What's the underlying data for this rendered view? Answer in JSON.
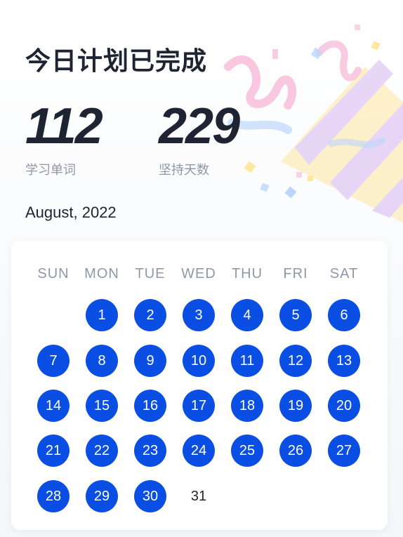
{
  "header": {
    "title": "今日计划已完成"
  },
  "stats": [
    {
      "value": "112",
      "label": "学习单词"
    },
    {
      "value": "229",
      "label": "坚持天数"
    }
  ],
  "calendar": {
    "month_label": "August, 2022",
    "weekdays": [
      "SUN",
      "MON",
      "TUE",
      "WED",
      "THU",
      "FRI",
      "SAT"
    ],
    "days": [
      {
        "n": "1",
        "done": true
      },
      {
        "n": "2",
        "done": true
      },
      {
        "n": "3",
        "done": true
      },
      {
        "n": "4",
        "done": true
      },
      {
        "n": "5",
        "done": true
      },
      {
        "n": "6",
        "done": true
      },
      {
        "n": "7",
        "done": true
      },
      {
        "n": "8",
        "done": true
      },
      {
        "n": "9",
        "done": true
      },
      {
        "n": "10",
        "done": true
      },
      {
        "n": "11",
        "done": true
      },
      {
        "n": "12",
        "done": true
      },
      {
        "n": "13",
        "done": true
      },
      {
        "n": "14",
        "done": true
      },
      {
        "n": "15",
        "done": true
      },
      {
        "n": "16",
        "done": true
      },
      {
        "n": "17",
        "done": true
      },
      {
        "n": "18",
        "done": true
      },
      {
        "n": "19",
        "done": true
      },
      {
        "n": "20",
        "done": true
      },
      {
        "n": "21",
        "done": true
      },
      {
        "n": "22",
        "done": true
      },
      {
        "n": "23",
        "done": true
      },
      {
        "n": "24",
        "done": true
      },
      {
        "n": "25",
        "done": true
      },
      {
        "n": "26",
        "done": true
      },
      {
        "n": "27",
        "done": true
      },
      {
        "n": "28",
        "done": true
      },
      {
        "n": "29",
        "done": true
      },
      {
        "n": "30",
        "done": true
      },
      {
        "n": "31",
        "done": false
      }
    ]
  },
  "colors": {
    "accent": "#0a4ee4",
    "text": "#1f2433",
    "muted": "#8e98a8"
  },
  "decoration": {
    "icon": "party-popper-icon"
  }
}
